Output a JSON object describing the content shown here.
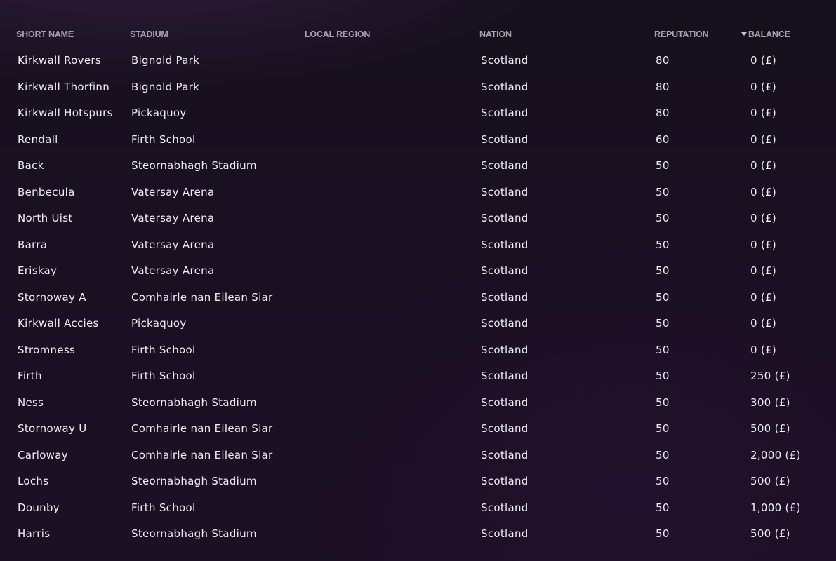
{
  "columns": {
    "short_name": "SHORT NAME",
    "stadium": "STADIUM",
    "local_region": "LOCAL REGION",
    "nation": "NATION",
    "reputation": "REPUTATION",
    "balance": "BALANCE"
  },
  "sort": {
    "column": "balance",
    "icon": "sort-down-icon"
  },
  "rows": [
    {
      "name": "Kirkwall Rovers",
      "stadium": "Bignold Park",
      "region": "",
      "nation": "Scotland",
      "reputation": "80",
      "balance": "0 (£)"
    },
    {
      "name": "Kirkwall Thorfinn",
      "stadium": "Bignold Park",
      "region": "",
      "nation": "Scotland",
      "reputation": "80",
      "balance": "0 (£)"
    },
    {
      "name": "Kirkwall Hotspurs",
      "stadium": "Pickaquoy",
      "region": "",
      "nation": "Scotland",
      "reputation": "80",
      "balance": "0 (£)"
    },
    {
      "name": "Rendall",
      "stadium": "Firth School",
      "region": "",
      "nation": "Scotland",
      "reputation": "60",
      "balance": "0 (£)"
    },
    {
      "name": "Back",
      "stadium": "Steornabhagh Stadium",
      "region": "",
      "nation": "Scotland",
      "reputation": "50",
      "balance": "0 (£)"
    },
    {
      "name": "Benbecula",
      "stadium": "Vatersay Arena",
      "region": "",
      "nation": "Scotland",
      "reputation": "50",
      "balance": "0 (£)"
    },
    {
      "name": "North Uist",
      "stadium": "Vatersay Arena",
      "region": "",
      "nation": "Scotland",
      "reputation": "50",
      "balance": "0 (£)"
    },
    {
      "name": "Barra",
      "stadium": "Vatersay Arena",
      "region": "",
      "nation": "Scotland",
      "reputation": "50",
      "balance": "0 (£)"
    },
    {
      "name": "Eriskay",
      "stadium": "Vatersay Arena",
      "region": "",
      "nation": "Scotland",
      "reputation": "50",
      "balance": "0 (£)"
    },
    {
      "name": "Stornoway A",
      "stadium": "Comhairle nan Eilean Siar",
      "region": "",
      "nation": "Scotland",
      "reputation": "50",
      "balance": "0 (£)"
    },
    {
      "name": "Kirkwall Accies",
      "stadium": "Pickaquoy",
      "region": "",
      "nation": "Scotland",
      "reputation": "50",
      "balance": "0 (£)"
    },
    {
      "name": "Stromness",
      "stadium": "Firth School",
      "region": "",
      "nation": "Scotland",
      "reputation": "50",
      "balance": "0 (£)"
    },
    {
      "name": "Firth",
      "stadium": "Firth School",
      "region": "",
      "nation": "Scotland",
      "reputation": "50",
      "balance": "250 (£)"
    },
    {
      "name": "Ness",
      "stadium": "Steornabhagh Stadium",
      "region": "",
      "nation": "Scotland",
      "reputation": "50",
      "balance": "300 (£)"
    },
    {
      "name": "Stornoway U",
      "stadium": "Comhairle nan Eilean Siar",
      "region": "",
      "nation": "Scotland",
      "reputation": "50",
      "balance": "500 (£)"
    },
    {
      "name": "Carloway",
      "stadium": "Comhairle nan Eilean Siar",
      "region": "",
      "nation": "Scotland",
      "reputation": "50",
      "balance": "2,000 (£)"
    },
    {
      "name": "Lochs",
      "stadium": "Steornabhagh Stadium",
      "region": "",
      "nation": "Scotland",
      "reputation": "50",
      "balance": "500 (£)"
    },
    {
      "name": "Dounby",
      "stadium": "Firth School",
      "region": "",
      "nation": "Scotland",
      "reputation": "50",
      "balance": "1,000 (£)"
    },
    {
      "name": "Harris",
      "stadium": "Steornabhagh Stadium",
      "region": "",
      "nation": "Scotland",
      "reputation": "50",
      "balance": "500 (£)"
    }
  ]
}
